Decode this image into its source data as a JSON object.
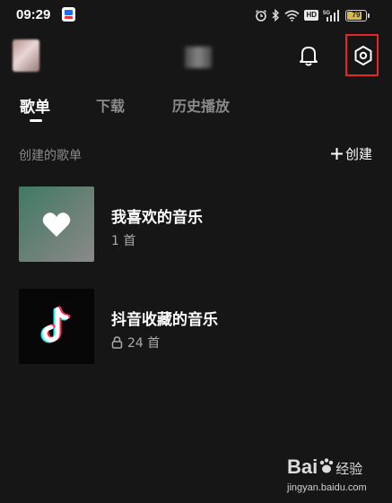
{
  "status_bar": {
    "time": "09:29",
    "network_label": "HD",
    "signal_label": "5G",
    "battery_level": 79,
    "battery_text": "79",
    "icons": [
      "alarm-icon",
      "bluetooth-icon",
      "wifi-icon",
      "hd-icon",
      "signal-icon",
      "battery-icon"
    ]
  },
  "header": {
    "bell_icon": "bell-icon",
    "settings_icon": "settings-hexagon-icon",
    "highlight_color": "#e8262a"
  },
  "tabs": [
    {
      "label": "歌单",
      "active": true
    },
    {
      "label": "下载",
      "active": false
    },
    {
      "label": "历史播放",
      "active": false
    }
  ],
  "section": {
    "title": "创建的歌单",
    "create_label": "创建"
  },
  "playlists": [
    {
      "name": "我喜欢的音乐",
      "count": "1 首",
      "locked": false,
      "cover": "heart-icon"
    },
    {
      "name": "抖音收藏的音乐",
      "count": "24 首",
      "locked": true,
      "cover": "douyin-logo-icon"
    }
  ],
  "watermark": {
    "logo_text": "Bai",
    "logo_cn": "经验",
    "url": "jingyan.baidu.com"
  },
  "colors": {
    "background": "#161616",
    "text_primary": "#ffffff",
    "text_secondary": "#8a8a8a"
  }
}
